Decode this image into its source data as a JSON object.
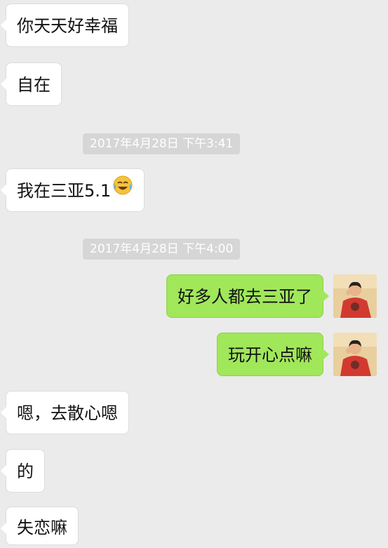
{
  "messages": [
    {
      "side": "in",
      "text": "你天天好幸福"
    },
    {
      "side": "in",
      "text": "自在"
    },
    {
      "type": "timestamp",
      "text": "2017年4月28日 下午3:41"
    },
    {
      "side": "in",
      "text": "我在三亚5.1",
      "emoji": "crying-laughing-emoji"
    },
    {
      "type": "timestamp",
      "text": "2017年4月28日 下午4:00"
    },
    {
      "side": "out",
      "text": "好多人都去三亚了"
    },
    {
      "side": "out",
      "text": "玩开心点嘛"
    },
    {
      "side": "in",
      "text": "嗯，去散心嗯"
    },
    {
      "side": "in",
      "text": "的"
    },
    {
      "side": "in",
      "text": "失恋嘛"
    }
  ],
  "colors": {
    "background": "#ebebeb",
    "incoming_bubble": "#ffffff",
    "outgoing_bubble": "#a0e75a",
    "timestamp_bg": "#d6d6d6",
    "timestamp_text": "#ffffff"
  }
}
